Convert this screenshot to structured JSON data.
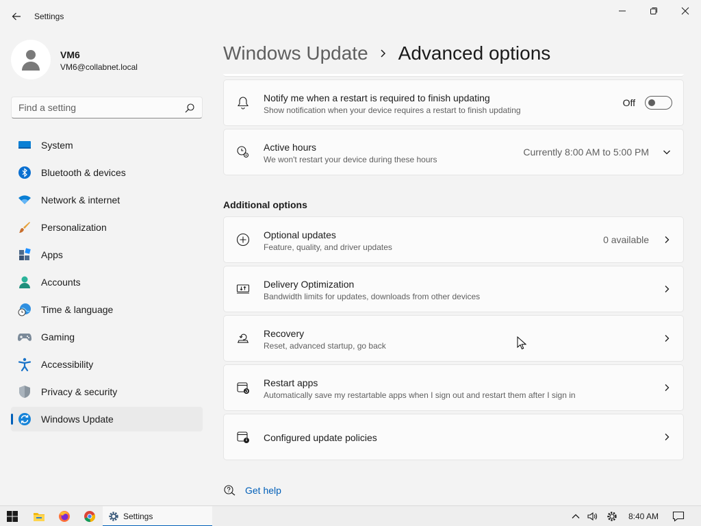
{
  "window": {
    "app_title": "Settings",
    "back_icon": "arrow-left-icon",
    "controls": [
      "minimize-icon",
      "maximize-icon",
      "close-icon"
    ]
  },
  "profile": {
    "name": "VM6",
    "email": "VM6@collabnet.local",
    "avatar_icon": "person-icon"
  },
  "search": {
    "placeholder": "Find a setting",
    "icon": "search-icon"
  },
  "sidebar": {
    "items": [
      {
        "label": "System",
        "icon": "system-icon",
        "active": false
      },
      {
        "label": "Bluetooth & devices",
        "icon": "bluetooth-icon",
        "active": false
      },
      {
        "label": "Network & internet",
        "icon": "wifi-icon",
        "active": false
      },
      {
        "label": "Personalization",
        "icon": "brush-icon",
        "active": false
      },
      {
        "label": "Apps",
        "icon": "apps-icon",
        "active": false
      },
      {
        "label": "Accounts",
        "icon": "accounts-icon",
        "active": false
      },
      {
        "label": "Time & language",
        "icon": "globe-clock-icon",
        "active": false
      },
      {
        "label": "Gaming",
        "icon": "gamepad-icon",
        "active": false
      },
      {
        "label": "Accessibility",
        "icon": "accessibility-icon",
        "active": false
      },
      {
        "label": "Privacy & security",
        "icon": "shield-icon",
        "active": false
      },
      {
        "label": "Windows Update",
        "icon": "update-icon",
        "active": true
      }
    ]
  },
  "header": {
    "parent": "Windows Update",
    "current": "Advanced options"
  },
  "cards_top": [
    {
      "title": "Notify me when a restart is required to finish updating",
      "description": "Show notification when your device requires a restart to finish updating",
      "icon": "bell-icon",
      "toggle_label": "Off",
      "toggle_on": false
    },
    {
      "title": "Active hours",
      "description": "We won't restart your device during these hours",
      "icon": "clock-gear-icon",
      "value": "Currently 8:00 AM to 5:00 PM",
      "chevron": "chevron-down-icon"
    }
  ],
  "additional": {
    "header": "Additional options",
    "items": [
      {
        "title": "Optional updates",
        "description": "Feature, quality, and driver updates",
        "icon": "plus-circle-icon",
        "value": "0 available"
      },
      {
        "title": "Delivery Optimization",
        "description": "Bandwidth limits for updates, downloads from other devices",
        "icon": "delivery-icon",
        "value": ""
      },
      {
        "title": "Recovery",
        "description": "Reset, advanced startup, go back",
        "icon": "recovery-icon",
        "value": ""
      },
      {
        "title": "Restart apps",
        "description": "Automatically save my restartable apps when I sign out and restart them after I sign in",
        "icon": "restart-apps-icon",
        "value": ""
      },
      {
        "title": "Configured update policies",
        "description": "",
        "icon": "policy-icon",
        "value": ""
      }
    ]
  },
  "help": {
    "label": "Get help",
    "icon": "help-icon"
  },
  "taskbar": {
    "icons": [
      "start-icon",
      "file-explorer-icon",
      "firefox-icon",
      "chrome-icon"
    ],
    "active_app": "Settings",
    "tray_icons": [
      "chevron-up-icon",
      "volume-icon",
      "settings-gear-icon"
    ],
    "time": "8:40 AM",
    "notification_icon": "notification-icon"
  },
  "colors": {
    "accent": "#005fb8",
    "background": "#f3f3f3",
    "card": "#fbfbfb"
  }
}
